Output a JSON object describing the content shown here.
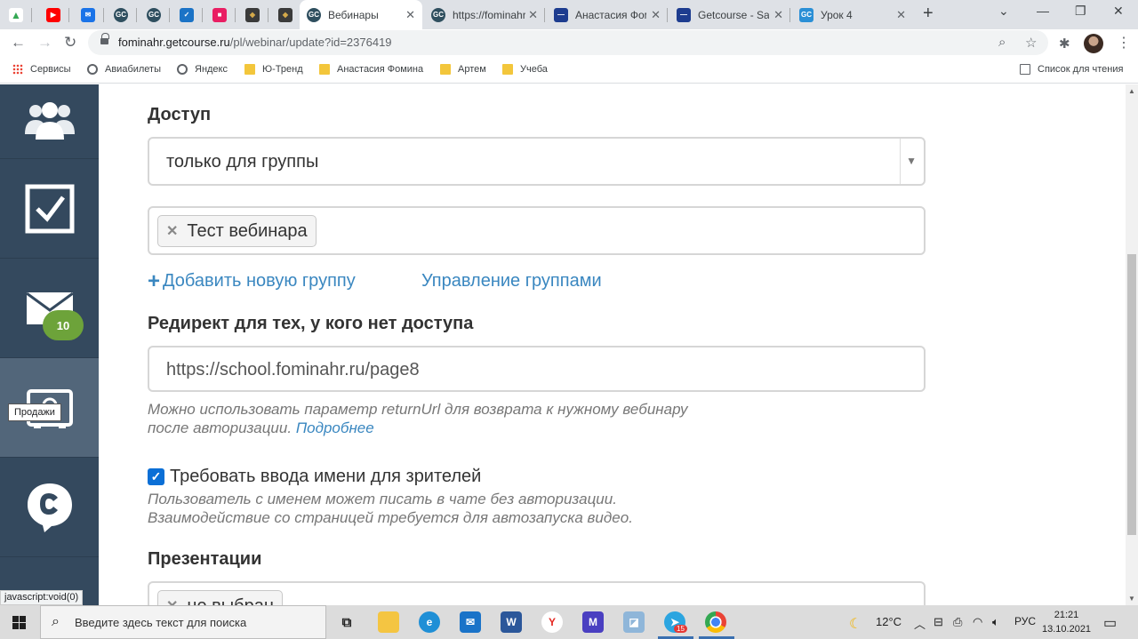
{
  "browser": {
    "tabs": [
      {
        "title": "",
        "favicon_color": "#34a853",
        "favicon_text": "▲"
      },
      {
        "title": "",
        "favicon_color": "#ff0000",
        "favicon_text": "▶"
      },
      {
        "title": "",
        "favicon_color": "#1a73e8",
        "favicon_text": "✉"
      },
      {
        "title": "",
        "favicon_color": "#2f4f5f",
        "favicon_text": "GC"
      },
      {
        "title": "",
        "favicon_color": "#2f4f5f",
        "favicon_text": "GC"
      },
      {
        "title": "",
        "favicon_color": "#1b73c6",
        "favicon_text": "✓"
      },
      {
        "title": "",
        "favicon_color": "#e91e63",
        "favicon_text": "■"
      },
      {
        "title": "",
        "favicon_color": "#3a3a3a",
        "favicon_text": "◆"
      },
      {
        "title": "",
        "favicon_color": "#3a3a3a",
        "favicon_text": "◆"
      },
      {
        "title": "Вебинары",
        "favicon_color": "#2f4f5f",
        "favicon_text": "GC"
      },
      {
        "title": "https://fominahr",
        "favicon_color": "#2f4f5f",
        "favicon_text": "GC"
      },
      {
        "title": "Анастасия Фомина",
        "favicon_color": "#1d3c8f",
        "favicon_text": "—"
      },
      {
        "title": "Getcourse - Sale",
        "favicon_color": "#1d3c8f",
        "favicon_text": "—"
      },
      {
        "title": "Урок 4",
        "favicon_color": "#2a8fd6",
        "favicon_text": "GC"
      }
    ],
    "url_domain": "fominahr.getcourse.ru",
    "url_path": "/pl/webinar/update?id=2376419",
    "bookmarks": [
      "Сервисы",
      "Авиабилеты",
      "Яндекс",
      "Ю-Тренд",
      "Анастасия Фомина",
      "Артем",
      "Учеба"
    ],
    "reading_list": "Список для чтения",
    "status_text": "javascript:void(0)"
  },
  "sidebar": {
    "items": [
      {
        "icon": "users-icon"
      },
      {
        "icon": "checkbox-icon"
      },
      {
        "icon": "mail-icon",
        "badge": "10"
      },
      {
        "icon": "sales-icon",
        "tooltip": "Продажи"
      },
      {
        "icon": "chat-icon"
      }
    ]
  },
  "form": {
    "access_label": "Доступ",
    "access_value": "только для группы",
    "group_tag": "Тест вебинара",
    "add_group_link": "Добавить новую группу",
    "manage_groups_link": "Управление группами",
    "redirect_label": "Редирект для тех, у кого нет доступа",
    "redirect_value": "https://school.fominahr.ru/page8",
    "redirect_hint_1": "Можно использовать параметр returnUrl для возврата к нужному вебинару",
    "redirect_hint_2": "после авторизации.",
    "redirect_hint_more": "Подробнее",
    "require_name_label": "Требовать ввода имени для зрителей",
    "require_name_checked": true,
    "require_name_hint_1": "Пользователь с именем может писать в чате без авторизации.",
    "require_name_hint_2": "Взаимодействие со страницей требуется для автозапуска видео.",
    "presentations_label": "Презентации",
    "presentations_value": "не выбран"
  },
  "taskbar": {
    "search_placeholder": "Введите здесь текст для поиска",
    "weather": "12°C",
    "language": "РУС",
    "time": "21:21",
    "date": "13.10.2021",
    "telegram_badge": "15"
  },
  "colors": {
    "sidebar_bg": "#34495e",
    "badge_green": "#6da33a",
    "link_blue": "#3a87c0",
    "checkbox_blue": "#0b6fd6"
  }
}
